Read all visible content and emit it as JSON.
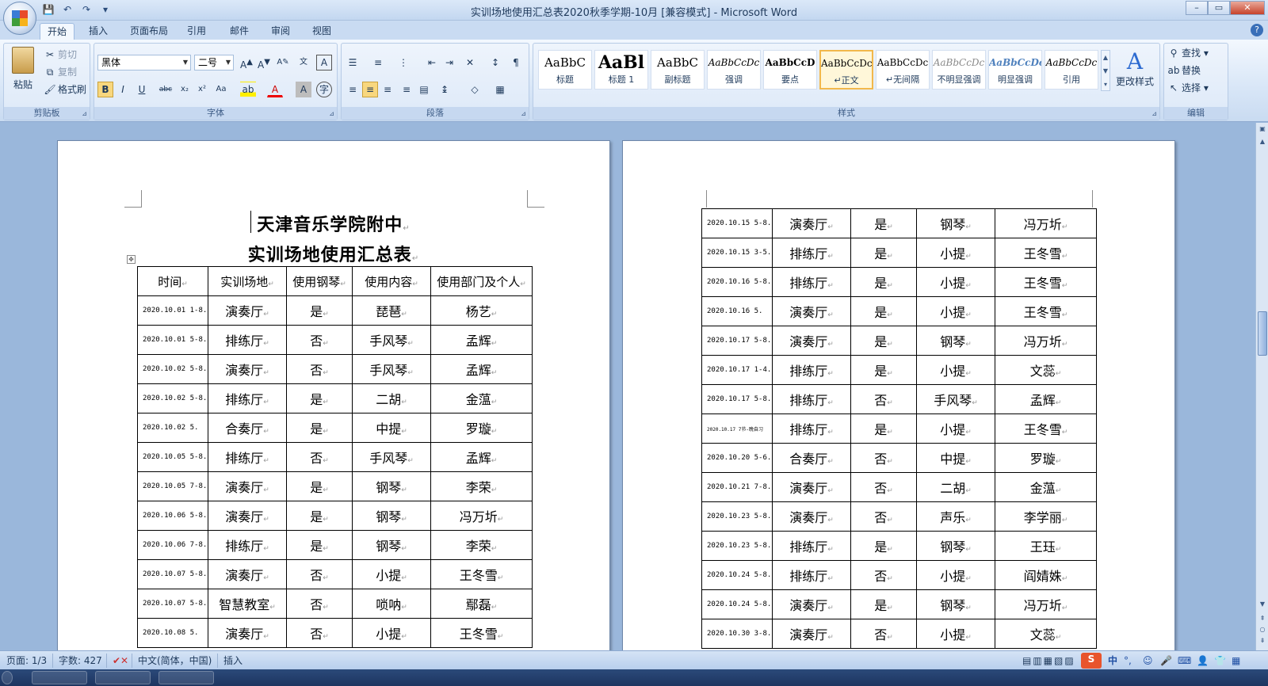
{
  "window": {
    "title": "实训场地使用汇总表2020秋季学期-10月 [兼容模式] - Microsoft Word",
    "controls": [
      "–",
      "▭",
      "✕"
    ]
  },
  "tabs": [
    "开始",
    "插入",
    "页面布局",
    "引用",
    "邮件",
    "审阅",
    "视图"
  ],
  "active_tab": "开始",
  "ribbon": {
    "clipboard": {
      "paste": "粘贴",
      "cut": "剪切",
      "copy": "复制",
      "format_painter": "格式刷",
      "label": "剪贴板"
    },
    "font": {
      "name": "黑体",
      "size": "二号",
      "label": "字体"
    },
    "paragraph": {
      "label": "段落"
    },
    "styles": {
      "label": "样式",
      "items": [
        {
          "sample": "AaBbC",
          "name": "标题"
        },
        {
          "sample": "AaBl",
          "name": "标题 1"
        },
        {
          "sample": "AaBbC",
          "name": "副标题"
        },
        {
          "sample": "AaBbCcDc",
          "name": "强调"
        },
        {
          "sample": "AaBbCcD",
          "name": "要点"
        },
        {
          "sample": "AaBbCcDc",
          "name": "↵正文"
        },
        {
          "sample": "AaBbCcDc",
          "name": "↵无间隔"
        },
        {
          "sample": "AaBbCcDc",
          "name": "不明显强调"
        },
        {
          "sample": "AaBbCcDc",
          "name": "明显强调"
        },
        {
          "sample": "AaBbCcDc",
          "name": "引用"
        }
      ],
      "change_styles": "更改样式"
    },
    "editing": {
      "find": "查找",
      "replace": "替换",
      "select": "选择",
      "label": "编辑"
    }
  },
  "document": {
    "title_line1": "天津音乐学院附中",
    "title_line2": "实训场地使用汇总表",
    "headers": [
      "时间",
      "实训场地",
      "使用钢琴",
      "使用内容",
      "使用部门及个人"
    ],
    "page1_rows": [
      [
        "2020.10.01 1-8.",
        "演奏厅",
        "是",
        "琵琶",
        "杨艺"
      ],
      [
        "2020.10.01 5-8.",
        "排练厅",
        "否",
        "手风琴",
        "孟辉"
      ],
      [
        "2020.10.02 5-8.",
        "演奏厅",
        "否",
        "手风琴",
        "孟辉"
      ],
      [
        "2020.10.02 5-8.",
        "排练厅",
        "是",
        "二胡",
        "金蕰"
      ],
      [
        "2020.10.02   5.",
        "合奏厅",
        "是",
        "中提",
        "罗璇"
      ],
      [
        "2020.10.05 5-8.",
        "排练厅",
        "否",
        "手风琴",
        "孟辉"
      ],
      [
        "2020.10.05 7-8.",
        "演奏厅",
        "是",
        "钢琴",
        "李荣"
      ],
      [
        "2020.10.06 5-8.",
        "演奏厅",
        "是",
        "钢琴",
        "冯万圻"
      ],
      [
        "2020.10.06 7-8.",
        "排练厅",
        "是",
        "钢琴",
        "李荣"
      ],
      [
        "2020.10.07 5-8.",
        "演奏厅",
        "否",
        "小提",
        "王冬雪"
      ],
      [
        "2020.10.07 5-8.",
        "智慧教室",
        "否",
        "唢呐",
        "鄢磊"
      ],
      [
        "2020.10.08   5.",
        "演奏厅",
        "否",
        "小提",
        "王冬雪"
      ]
    ],
    "page2_rows": [
      [
        "2020.10.15 5-8.",
        "演奏厅",
        "是",
        "钢琴",
        "冯万圻"
      ],
      [
        "2020.10.15 3-5.",
        "排练厅",
        "是",
        "小提",
        "王冬雪"
      ],
      [
        "2020.10.16 5-8.",
        "排练厅",
        "是",
        "小提",
        "王冬雪"
      ],
      [
        "2020.10.16    5.",
        "演奏厅",
        "是",
        "小提",
        "王冬雪"
      ],
      [
        "2020.10.17 5-8.",
        "演奏厅",
        "是",
        "钢琴",
        "冯万圻"
      ],
      [
        "2020.10.17 1-4.",
        "排练厅",
        "是",
        "小提",
        "文蕊"
      ],
      [
        "2020.10.17 5-8.",
        "排练厅",
        "否",
        "手风琴",
        "孟辉"
      ],
      [
        "2020.10.17 7节-晚自习",
        "排练厅",
        "是",
        "小提",
        "王冬雪"
      ],
      [
        "2020.10.20 5-6.",
        "合奏厅",
        "否",
        "中提",
        "罗璇"
      ],
      [
        "2020.10.21 7-8.",
        "演奏厅",
        "否",
        "二胡",
        "金蕰"
      ],
      [
        "2020.10.23 5-8.",
        "演奏厅",
        "否",
        "声乐",
        "李学丽"
      ],
      [
        "2020.10.23 5-8.",
        "排练厅",
        "是",
        "钢琴",
        "王珏"
      ],
      [
        "2020.10.24 5-8.",
        "排练厅",
        "否",
        "小提",
        "阎婧姝"
      ],
      [
        "2020.10.24 5-8.",
        "演奏厅",
        "是",
        "钢琴",
        "冯万圻"
      ],
      [
        "2020.10.30 3-8.",
        "演奏厅",
        "否",
        "小提",
        "文蕊"
      ]
    ]
  },
  "status": {
    "page": "页面: 1/3",
    "words": "字数: 427",
    "language": "中文(简体，中国)",
    "mode": "插入",
    "ime": "中"
  }
}
